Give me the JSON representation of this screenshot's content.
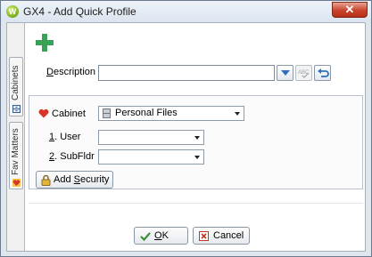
{
  "window": {
    "title": "GX4 - Add Quick Profile",
    "close_glyph": "✕",
    "app_glyph": "W"
  },
  "side_tabs": [
    {
      "label": "Cabinets",
      "icon": "cabinet-icon"
    },
    {
      "label": "Fav Matters",
      "icon": "heart-icon"
    }
  ],
  "toolbar": {
    "add_icon": "plus-icon"
  },
  "description": {
    "label_pre": "",
    "label_acc": "D",
    "label_post": "escription",
    "value": ""
  },
  "cabinet": {
    "label": "Cabinet",
    "selected": "Personal Files",
    "icon": "cabinet-icon"
  },
  "user": {
    "label_acc": "1",
    "label_post": ". User",
    "value": ""
  },
  "subfldr": {
    "label_acc": "2",
    "label_post": ". SubFldr",
    "value": ""
  },
  "add_security": {
    "label_pre": "Add ",
    "label_acc": "S",
    "label_post": "ecurity"
  },
  "ok": {
    "label_acc": "O",
    "label_post": "K"
  },
  "cancel": {
    "label": "Cancel"
  },
  "colors": {
    "accent": "#3aa158",
    "heart": "#d9342b",
    "close": "#c7432a"
  }
}
